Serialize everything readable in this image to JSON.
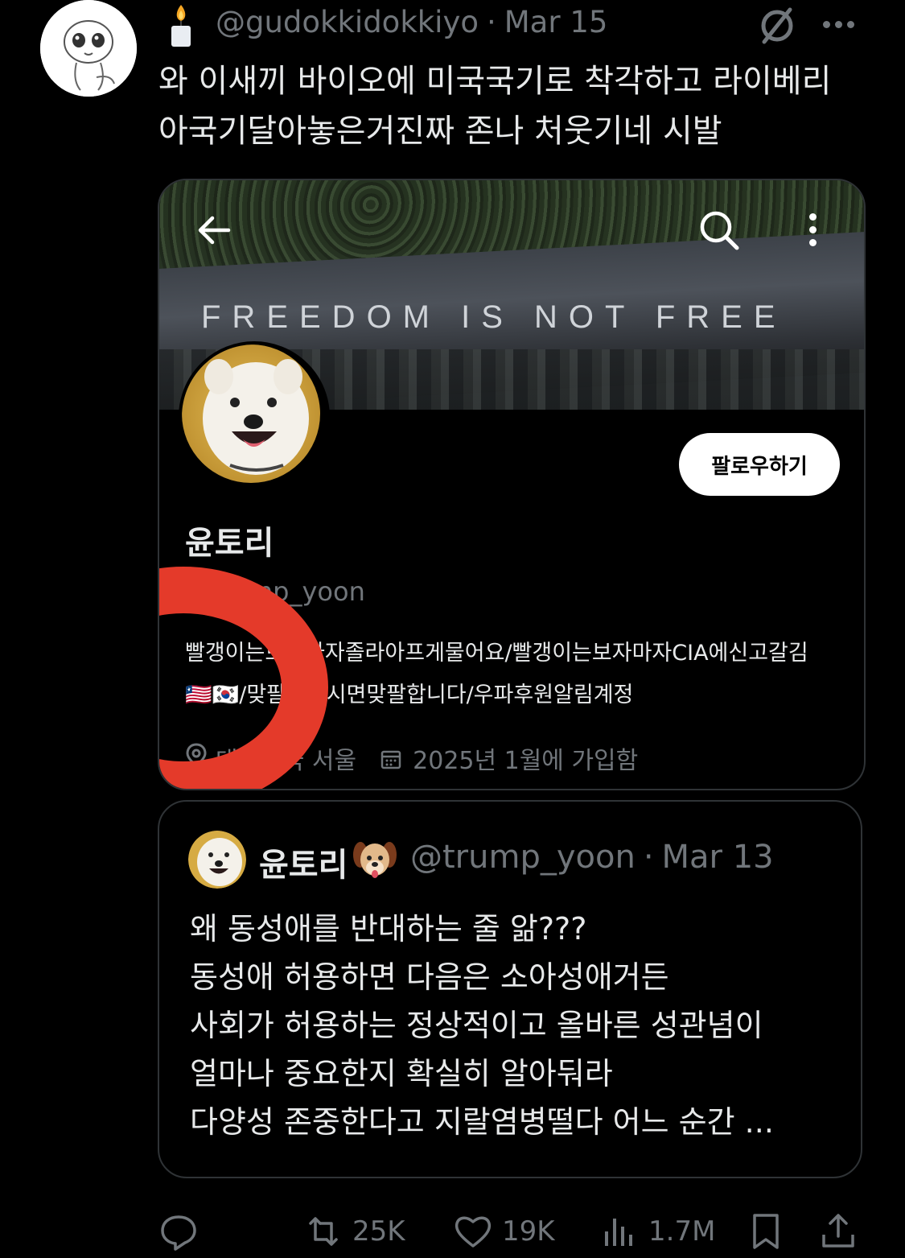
{
  "tweet": {
    "handle": "@gudokkidokkiyo",
    "separator": "·",
    "date": "Mar 15",
    "text_lines": [
      "와 이새끼 바이오에 미국국기로 착각하고 라이베리",
      "아국기달아놓은거진짜 존나 처웃기네 시발"
    ]
  },
  "media": {
    "banner_text": "FREEDOM IS NOT FREE",
    "follow_label": "팔로우하기",
    "profile_name": "윤토리",
    "profile_handle": "@trump_yoon",
    "bio_lines": [
      "빨갱이는보자마자졸라아프게물어요/빨갱이는보자마자CIA에신고갈김",
      "🇱🇷🇰🇷/맞팔로하시면맞팔합니다/우파후원알림계정"
    ],
    "location": "대한민국 서울",
    "joined": "2025년 1월에 가입함"
  },
  "quote": {
    "name": "윤토리",
    "handle": "@trump_yoon",
    "separator": "·",
    "date": "Mar 13",
    "text_lines": [
      "왜 동성애를 반대하는 줄 앎???",
      "동성애 허용하면 다음은 소아성애거든",
      "사회가 허용하는 정상적이고 올바른 성관념이",
      "얼마나 중요한지 확실히 알아둬라",
      "다양성 존중한다고 지랄염병떨다 어느 순간 ..."
    ]
  },
  "actions": {
    "retweets": "25K",
    "likes": "19K",
    "views": "1.7M"
  },
  "colors": {
    "background": "#000000",
    "text": "#e7e9ea",
    "muted": "#71767b",
    "border": "#2f3336",
    "highlight_ring": "#e43a2a"
  }
}
